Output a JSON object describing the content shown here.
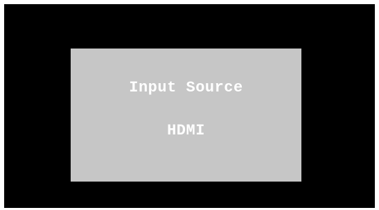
{
  "osd": {
    "title": "Input Source",
    "value": "HDMI"
  },
  "colors": {
    "screen_background": "#000000",
    "panel_background": "#c6c6c6",
    "text": "#ffffff"
  }
}
